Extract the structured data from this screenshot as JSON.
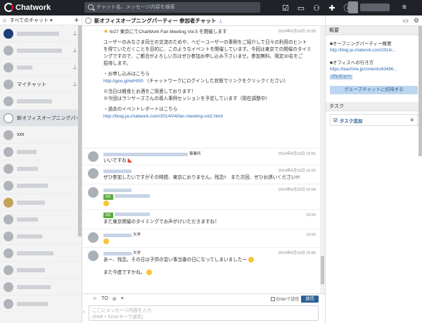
{
  "app": {
    "name": "Chatwork"
  },
  "search": {
    "placeholder": "チャット名、メッセージ内容を検索"
  },
  "sidebar": {
    "filter_label": "すべてのチャット",
    "rooms": [
      {
        "label": ""
      },
      {
        "label": ""
      },
      {
        "label": ""
      },
      {
        "label": "マイチャット"
      },
      {
        "label": ""
      },
      {
        "label": "新オフィスオープニングパー..."
      },
      {
        "label": "xxx"
      },
      {
        "label": ""
      },
      {
        "label": ""
      },
      {
        "label": ""
      },
      {
        "label": ""
      },
      {
        "label": ""
      },
      {
        "label": ""
      },
      {
        "label": ""
      },
      {
        "label": ""
      },
      {
        "label": ""
      },
      {
        "label": ""
      }
    ]
  },
  "chat": {
    "title": "新オフィスオープニングパーティー 参加者チャット",
    "messages": [
      {
        "time": "2014年6月10日 10:50",
        "line1": "6/27 東京にてChatWork Fan Meeting Vol.5 を開催します",
        "line2": "ユーザーのみなさま同士の交流のためや、ヘビーユーザーの事例をご紹介して日々の利用のヒント",
        "line3": "を得ていただくことを目的に、このようなイベントを開催しています。今回は東京での開催のタイミ",
        "line4": "ングですので、ご都合がよろしい方はぜひ参加お申し込み下さいませ。参加無料、限定30名をご",
        "line5": "招待します。",
        "line6": "・お申し込みはこちら",
        "link1": "http://goo.gl/wtHt00",
        "link1_note": "（チャットワークにログインした状態でリンクをクリックください）",
        "note1": "※当日は軽食とお酒をご用意しております！",
        "note2": "※今回はランサーズさんの導入事例セッションを予定しています（現在調整中）",
        "line7": "・過去のイベントレポートはこちら",
        "link2": "http://blog-ja.chatwork.com/2014/04/fan-meeting-vol2.html"
      },
      {
        "time": "2014年6月10日 10:51",
        "suffix": "事業所",
        "text": "いいですね"
      },
      {
        "time": "2014年6月10日 10:52",
        "text": "ぜひ参加したいですがその時間、東京におりません。残念!!　また次回、ぜひお誘いください!!!"
      },
      {
        "time": "2014年6月10日 10:54",
        "badge": "RE"
      },
      {
        "time": "10:55",
        "badge": "RE",
        "text": "また東京開催のタイミングでお声がけいただきますね！"
      },
      {
        "time": "10:55",
        "suffix": "大学"
      },
      {
        "time": "2014年6月10日 15:56",
        "suffix": "大学",
        "text": "あー、残念。その日は子供の習い事当番の日になってしまいましたー",
        "text2": "また今度ですかね。"
      }
    ]
  },
  "composer": {
    "to_label": "TO",
    "enter_label": "Enterで送信",
    "send_label": "送信",
    "placeholder_line1": "ここにメッセージ内容を入力",
    "placeholder_line2": "(Shift + Enterキーで送信)"
  },
  "right": {
    "overview_label": "概要",
    "item1_title": "■オープニングパーティー概要",
    "item1_link": "http://blog-ja.chatwork.com/2014/...",
    "item2_title": "■オフィスへの行き方",
    "item2_link": "https://teachme.jp/contents/63496...",
    "preview_label": "プレビュー",
    "invite_label": "グループチャットに招待する",
    "task_label": "タスク",
    "task_add_label": "タスク追加"
  },
  "colors": {
    "topbar": "#1f2328",
    "accent": "#2e5f95",
    "link": "#2b68b3",
    "re_badge": "#5bab3c"
  }
}
